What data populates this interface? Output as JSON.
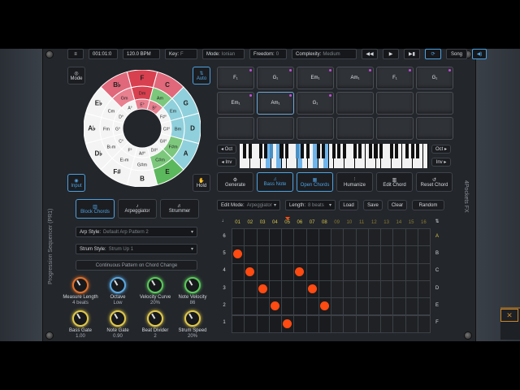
{
  "topbar": {
    "hamburger": "≡",
    "position": "001:01:0",
    "tempo": "120.0 BPM",
    "key_label": "Key:",
    "key_value": "F",
    "mode_label": "Mode:",
    "mode_value": "Ionian",
    "freedom_label": "Freedom:",
    "freedom_value": "0",
    "complexity_label": "Complexity:",
    "complexity_value": "Medium",
    "song": "Song"
  },
  "side_labels": {
    "left": "Progression Sequencer (PR1)",
    "right": "4Pockets FX"
  },
  "left_buttons": {
    "mode": "Mode",
    "auto": "Auto",
    "input": "Input",
    "hold": "Hold"
  },
  "wheel": {
    "outer": [
      "F",
      "C",
      "G",
      "D",
      "A",
      "E",
      "B",
      "F#",
      "D♭",
      "A♭",
      "E♭",
      "B♭"
    ],
    "middle": [
      "Dm",
      "Am",
      "Em",
      "Bm",
      "F#m",
      "C#m",
      "G#m",
      "E♭m",
      "B♭m",
      "Fm",
      "Cm",
      "Gm"
    ],
    "inner": [
      "E°",
      "B°",
      "F#°",
      "C#°",
      "G#°",
      "D#°",
      "A#°",
      "F°",
      "C°",
      "G°",
      "D°",
      "A°"
    ]
  },
  "pads": [
    {
      "label": "F₁",
      "dot": true
    },
    {
      "label": "G₁",
      "dot": true
    },
    {
      "label": "Em₁",
      "dot": true
    },
    {
      "label": "Am₁",
      "dot": true
    },
    {
      "label": "F₁",
      "dot": true
    },
    {
      "label": "G₁",
      "dot": true
    },
    {
      "label": "Em₁",
      "dot": true
    },
    {
      "label": "Am₁",
      "dot": true,
      "active": true
    },
    {
      "label": "G₁",
      "dot": true
    },
    {
      "label": "",
      "dot": false
    },
    {
      "label": "",
      "dot": false
    },
    {
      "label": "",
      "dot": false
    },
    {
      "label": "",
      "dot": false
    },
    {
      "label": "",
      "dot": false
    },
    {
      "label": "",
      "dot": false
    },
    {
      "label": "",
      "dot": false
    },
    {
      "label": "",
      "dot": false
    },
    {
      "label": "",
      "dot": false
    }
  ],
  "octave": {
    "oct_down": "◂ Oct",
    "oct_up": "Oct ▸",
    "inv_down": "◂ Inv",
    "inv_up": "Inv ▸"
  },
  "actions": [
    "Generate",
    "Bass Note",
    "Open Chords",
    "Humanize",
    "Edit Chord",
    "Reset Chord"
  ],
  "modes": [
    "Block Chords",
    "Arpeggiator",
    "Strummer"
  ],
  "arp_style": {
    "label": "Arp Style:",
    "value": "Default Arp Pattern 2"
  },
  "strum_style": {
    "label": "Strum Style:",
    "value": "Strum Up 1"
  },
  "continuous": "Continuous Pattern on Chord Change",
  "edit_mode": {
    "label": "Edit Mode:",
    "value": "Arpeggiator"
  },
  "length": {
    "label": "Length:",
    "value": "8 beats"
  },
  "grid_buttons": [
    "Load",
    "Save",
    "Clear",
    "Random"
  ],
  "grid": {
    "columns": [
      "01",
      "02",
      "03",
      "04",
      "05",
      "06",
      "07",
      "08",
      "09",
      "10",
      "11",
      "12",
      "13",
      "14",
      "15",
      "16"
    ],
    "rows": [
      "6",
      "5",
      "4",
      "3",
      "2",
      "1"
    ],
    "notes_right": [
      "A",
      "B",
      "C",
      "D",
      "E",
      "F"
    ],
    "notes": [
      [
        1,
        1
      ],
      [
        2,
        2
      ],
      [
        3,
        3
      ],
      [
        4,
        4
      ],
      [
        5,
        5
      ],
      [
        6,
        2
      ],
      [
        7,
        3
      ],
      [
        8,
        4
      ]
    ]
  },
  "knobs": [
    {
      "name": "Measure Length",
      "value": "4 beats",
      "color": "#e0702a"
    },
    {
      "name": "Octave",
      "value": "Low",
      "color": "#5aa8e0"
    },
    {
      "name": "Velocity Curve",
      "value": "20%",
      "color": "#5ac85a"
    },
    {
      "name": "Note Velocity",
      "value": "86",
      "color": "#5ac85a"
    },
    {
      "name": "Bass Gate",
      "value": "1.00",
      "color": "#e0c84a"
    },
    {
      "name": "Note Gate",
      "value": "0.90",
      "color": "#e0c84a"
    },
    {
      "name": "Beat Divider",
      "value": "2",
      "color": "#e0c84a"
    },
    {
      "name": "Strum Speed",
      "value": "20%",
      "color": "#e0c84a"
    }
  ]
}
